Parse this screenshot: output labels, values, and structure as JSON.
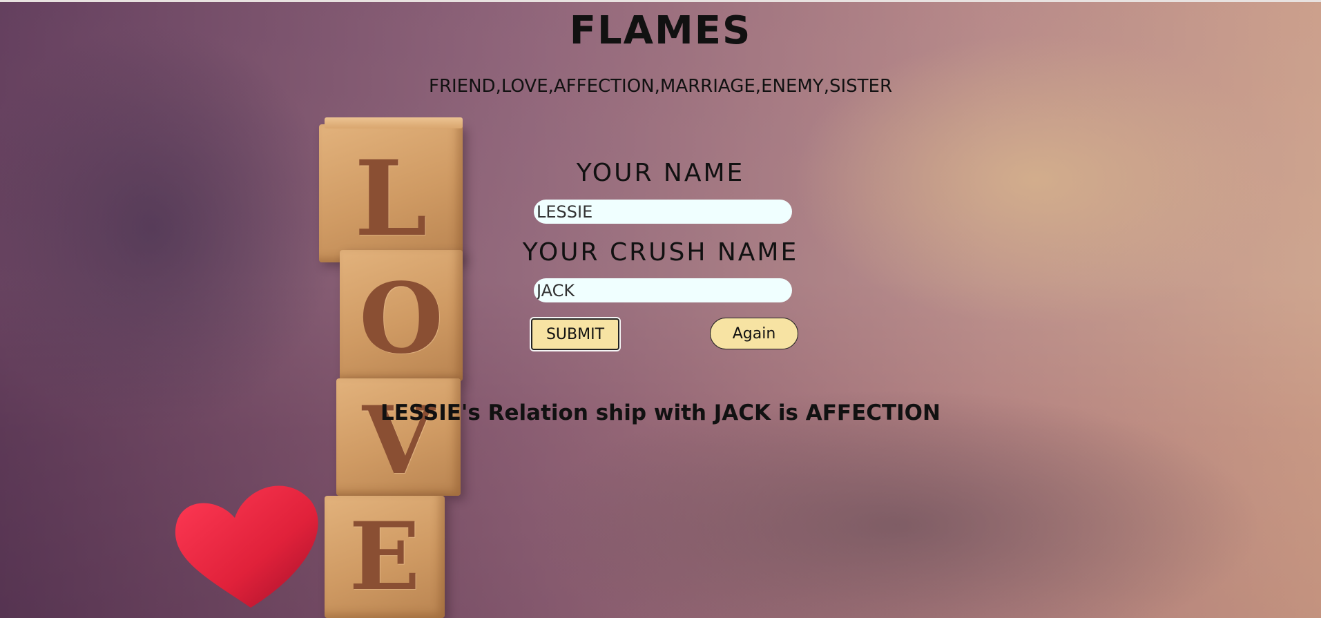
{
  "header": {
    "title": "FLAMES",
    "subtitle": "FRIEND,LOVE,AFFECTION,MARRIAGE,ENEMY,SISTER"
  },
  "form": {
    "your_name_label": "YOUR NAME",
    "your_name_value": "LESSIE",
    "crush_name_label": "YOUR CRUSH NAME",
    "crush_name_value": "JACK",
    "submit_label": "SUBMIT",
    "again_label": "Again"
  },
  "result": {
    "text": "LESSIE's Relation ship with JACK is AFFECTION"
  },
  "background": {
    "blocks": [
      "L",
      "O",
      "V",
      "E"
    ],
    "heart_color": "#e0213a"
  }
}
